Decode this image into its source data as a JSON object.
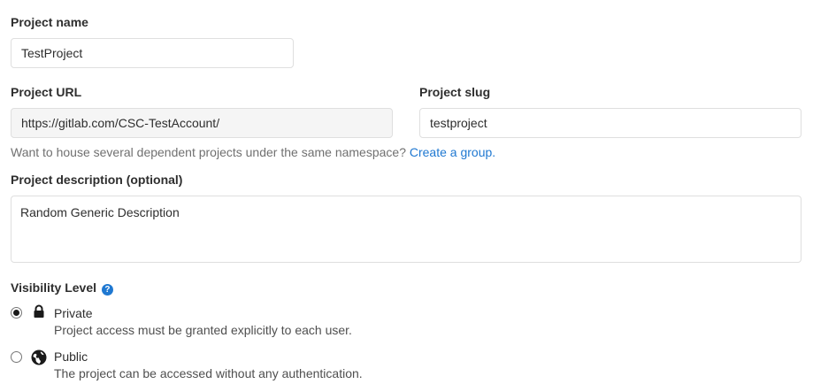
{
  "project_name": {
    "label": "Project name",
    "value": "TestProject"
  },
  "project_url": {
    "label": "Project URL",
    "value": "https://gitlab.com/CSC-TestAccount/"
  },
  "project_slug": {
    "label": "Project slug",
    "value": "testproject"
  },
  "namespace_help": {
    "text": "Want to house several dependent projects under the same namespace?",
    "link": "Create a group."
  },
  "project_description": {
    "label": "Project description (optional)",
    "value": "Random Generic Description"
  },
  "visibility": {
    "label": "Visibility Level",
    "help_icon": "question-circle-icon",
    "options": [
      {
        "title": "Private",
        "description": "Project access must be granted explicitly to each user.",
        "icon": "lock-icon",
        "selected": true
      },
      {
        "title": "Public",
        "description": "The project can be accessed without any authentication.",
        "icon": "globe-icon",
        "selected": false
      }
    ]
  },
  "colors": {
    "link": "#1f78d1",
    "text": "#2e2e2e",
    "muted": "#707070",
    "border": "#dfdfdf",
    "readonly_bg": "#f5f5f5"
  }
}
